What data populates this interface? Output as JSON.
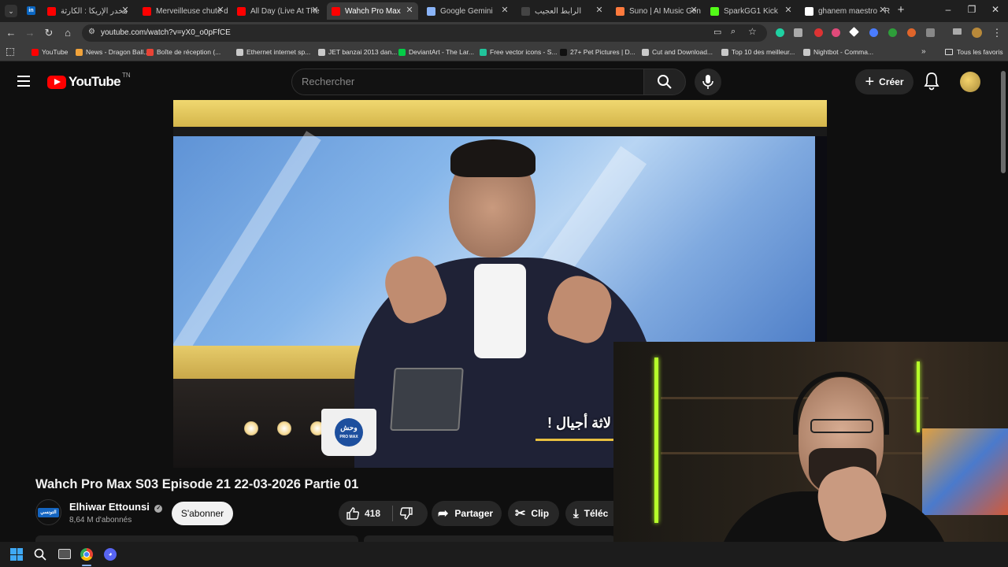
{
  "browser": {
    "tabs": [
      {
        "label": "مخدر الإريكا : الكارثة",
        "icon_color": "#ff0000",
        "active": false
      },
      {
        "label": "Merveilleuse chute d",
        "icon_color": "#ff0000",
        "active": false
      },
      {
        "label": "All Day (Live At The",
        "icon_color": "#ff0000",
        "active": false
      },
      {
        "label": "Wahch Pro Max",
        "icon_color": "#ff0000",
        "active": true
      },
      {
        "label": "Google Gemini",
        "icon_color": "#8ab4f8",
        "active": false
      },
      {
        "label": "الرابط العجيب",
        "icon_color": "#444444",
        "active": false
      },
      {
        "label": "Suno | AI Music Gen",
        "icon_color": "#ff7a3d",
        "active": false
      },
      {
        "label": "SparkGG1 Kick",
        "icon_color": "#53fc18",
        "active": false
      },
      {
        "label": "ghanem maestro - R",
        "icon_color": "#ffffff",
        "active": false
      }
    ],
    "url": "youtube.com/watch?v=yX0_o0pFfCE",
    "bookmarks": [
      {
        "label": "YouTube",
        "icon_color": "#ff0000"
      },
      {
        "label": "News - Dragon Ball...",
        "icon_color": "#f2a33a"
      },
      {
        "label": "Boîte de réception (...",
        "icon_color": "#ea4335"
      },
      {
        "label": "Ethernet internet sp...",
        "icon_color": "#c9c9c9"
      },
      {
        "label": "JET banzai 2013 dan...",
        "icon_color": "#c9c9c9"
      },
      {
        "label": "DeviantArt - The Lar...",
        "icon_color": "#05cc47"
      },
      {
        "label": "Free vector icons - S...",
        "icon_color": "#21c49b"
      },
      {
        "label": "27+ Pet Pictures | D...",
        "icon_color": "#111111"
      },
      {
        "label": "Cut and Download...",
        "icon_color": "#c9c9c9"
      },
      {
        "label": "Top 10 des meilleur...",
        "icon_color": "#c9c9c9"
      },
      {
        "label": "Nightbot - Comma...",
        "icon_color": "#c9c9c9"
      }
    ],
    "all_bookmarks": "Tous les favoris"
  },
  "youtube": {
    "logo_text": "YouTube",
    "country": "TN",
    "search_placeholder": "Rechercher",
    "create_label": "Créer",
    "video": {
      "title": "Wahch Pro Max S03 Episode 21 22-03-2026 Partie 01",
      "subtitle": "لاثة أجيال !",
      "mug_text": "وحش",
      "mug_subtext": "PRO MAX"
    },
    "channel": {
      "name": "Elhiwar Ettounsi",
      "verified": true,
      "subscribers": "8,64 M d'abonnés",
      "avatar_text": "التونسي"
    },
    "subscribe_label": "S'abonner",
    "likes": "418",
    "share_label": "Partager",
    "clip_label": "Clip",
    "download_label": "Téléc"
  },
  "colors": {
    "youtube_red": "#ff0000",
    "background": "#0f0f0f",
    "pill": "#272727"
  }
}
